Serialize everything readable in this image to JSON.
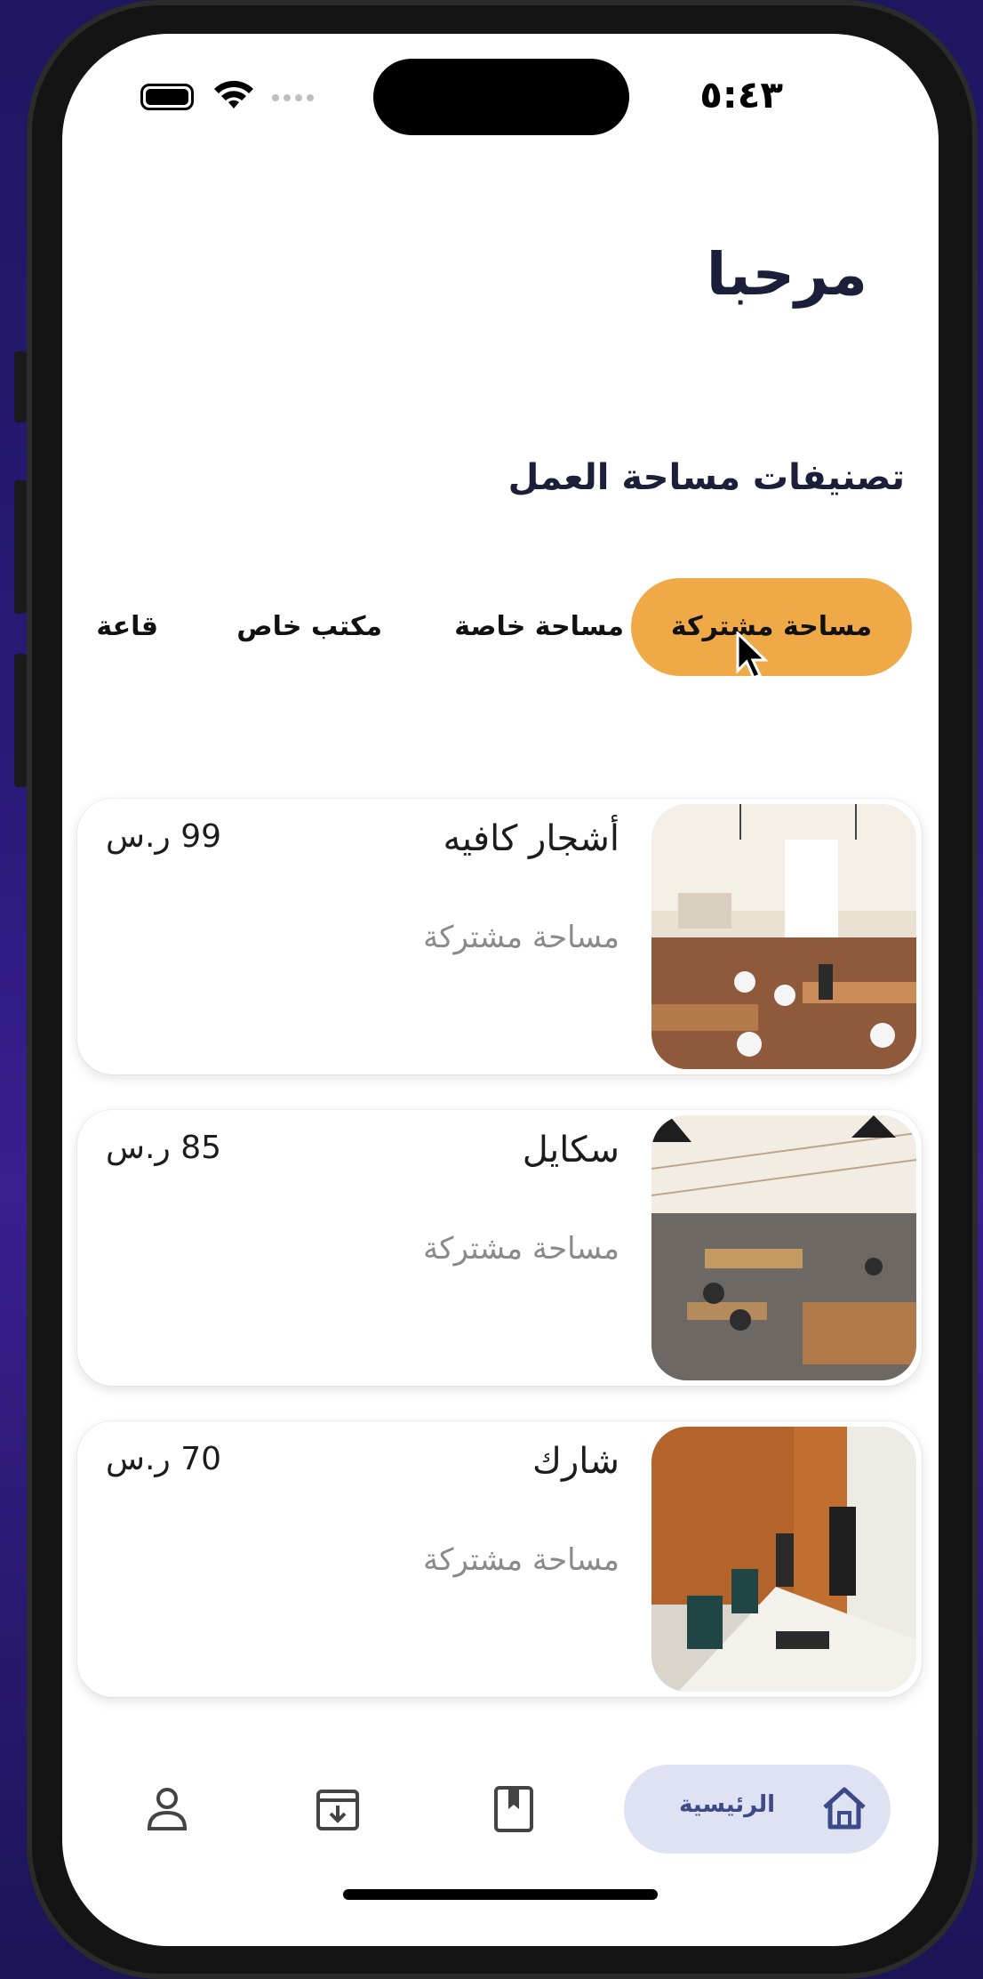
{
  "status_bar": {
    "time": "٥:٤٣"
  },
  "header": {
    "greeting": "مرحبا"
  },
  "categories_section": {
    "title": "تصنيفات مساحة العمل",
    "items": [
      {
        "label": "مساحة مشتركة",
        "active": true
      },
      {
        "label": "مساحة خاصة",
        "active": false
      },
      {
        "label": "مكتب خاص",
        "active": false
      },
      {
        "label": "قاعة",
        "active": false
      }
    ],
    "active_color": "#EFAA47"
  },
  "listings": [
    {
      "name": "أشجار كافيه",
      "type": "مساحة مشتركة",
      "price": "99 ر.س"
    },
    {
      "name": "سكايل",
      "type": "مساحة مشتركة",
      "price": "85 ر.س"
    },
    {
      "name": "شارك",
      "type": "مساحة مشتركة",
      "price": "70 ر.س"
    }
  ],
  "bottom_nav": {
    "items": [
      {
        "label": "الرئيسية",
        "icon": "home-icon",
        "active": true
      },
      {
        "label": "",
        "icon": "bookmark-icon",
        "active": false
      },
      {
        "label": "",
        "icon": "archive-download-icon",
        "active": false
      },
      {
        "label": "",
        "icon": "person-icon",
        "active": false
      }
    ]
  }
}
